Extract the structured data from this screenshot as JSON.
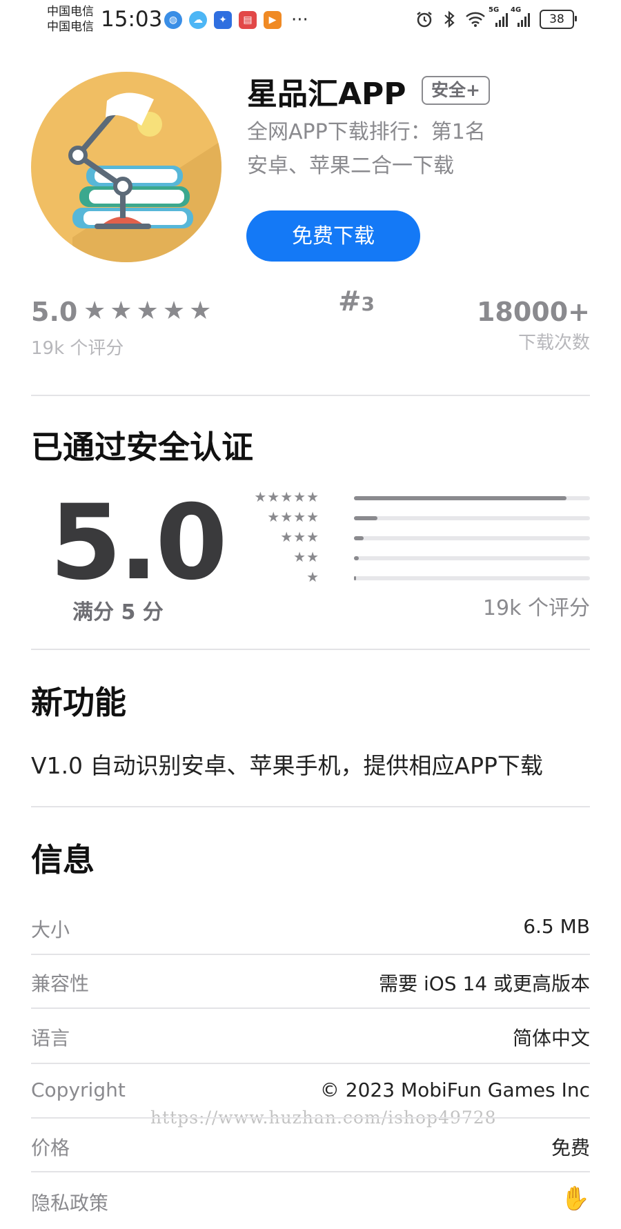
{
  "status_bar": {
    "carrier1": "中国电信",
    "carrier2": "中国电信",
    "time": "15:03",
    "network1": "5G",
    "network2": "4G",
    "battery": "38",
    "more": "···"
  },
  "app": {
    "name": "星品汇APP",
    "badge": "安全+",
    "ranking_line": "全网APP下载排行：第1名",
    "platform_line": "安卓、苹果二合一下载",
    "download_button": "免费下载"
  },
  "stats": {
    "rating": "5.0",
    "stars": "★★★★★",
    "rating_count": "19k 个评分",
    "rank_hash": "#",
    "rank_number": "3",
    "downloads": "18000+",
    "downloads_label": "下载次数"
  },
  "ratings_section": {
    "title": "已通过安全认证",
    "score": "5.0",
    "max_label": "满分 5 分",
    "count_label": "19k 个评分",
    "rows": [
      {
        "stars": "★★★★★",
        "fraction": 0.9
      },
      {
        "stars": "★★★★",
        "fraction": 0.1
      },
      {
        "stars": "★★★",
        "fraction": 0.04
      },
      {
        "stars": "★★",
        "fraction": 0.02
      },
      {
        "stars": "★",
        "fraction": 0.01
      }
    ]
  },
  "whats_new": {
    "title": "新功能",
    "text": "V1.0 自动识别安卓、苹果手机，提供相应APP下载"
  },
  "info": {
    "title": "信息",
    "rows": [
      {
        "label": "大小",
        "value": "6.5 MB"
      },
      {
        "label": "兼容性",
        "value": "需要 iOS 14 或更高版本"
      },
      {
        "label": "语言",
        "value": "简体中文"
      },
      {
        "label": "Copyright",
        "value": "© 2023 MobiFun Games Inc"
      },
      {
        "label": "价格",
        "value": "免费"
      },
      {
        "label": "隐私政策",
        "value": ""
      }
    ]
  },
  "watermark": "https://www.huzhan.com/ishop49728",
  "colors": {
    "accent": "#1479f6",
    "icon_bg": "#f0be63",
    "gray_text": "#8a8a8e"
  },
  "icons": [
    "alarm-icon",
    "bluetooth-icon",
    "wifi-icon",
    "signal-icon",
    "battery-icon",
    "hand-icon",
    "desk-lamp-books-icon"
  ]
}
